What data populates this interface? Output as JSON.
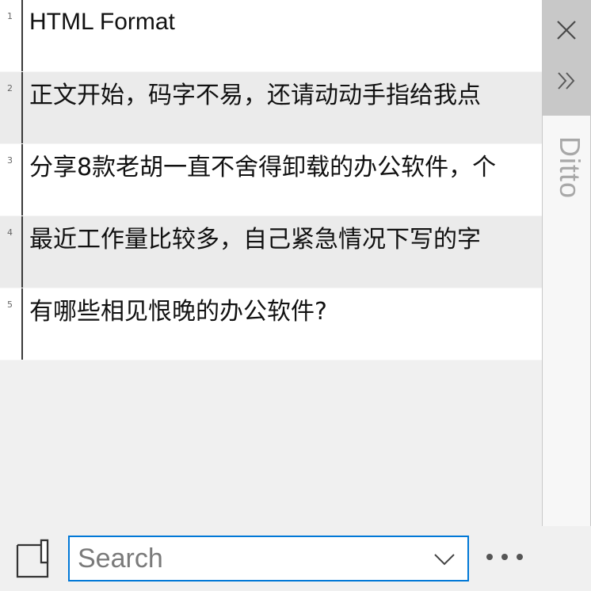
{
  "window": {
    "title": "Ditto"
  },
  "clips": [
    {
      "index": "1",
      "text": "HTML Format"
    },
    {
      "index": "2",
      "text": "正文开始，码字不易，还请动动手指给我点"
    },
    {
      "index": "3",
      "text": "分享8款老胡一直不舍得卸载的办公软件，个"
    },
    {
      "index": "4",
      "text": "最近工作量比较多，自己紧急情况下写的字"
    },
    {
      "index": "5",
      "text": "有哪些相见恨晚的办公软件?"
    }
  ],
  "search": {
    "placeholder": "Search",
    "value": ""
  },
  "icons": {
    "close": "close-icon",
    "expand": "double-chevron-right-icon",
    "note": "note-icon",
    "dropdown": "chevron-down-icon",
    "more": "more-dots-icon"
  },
  "colors": {
    "accent": "#0078d7",
    "side_panel": "#c8c8c8",
    "row_alt": "#ebebeb",
    "background": "#f0f0f0"
  }
}
